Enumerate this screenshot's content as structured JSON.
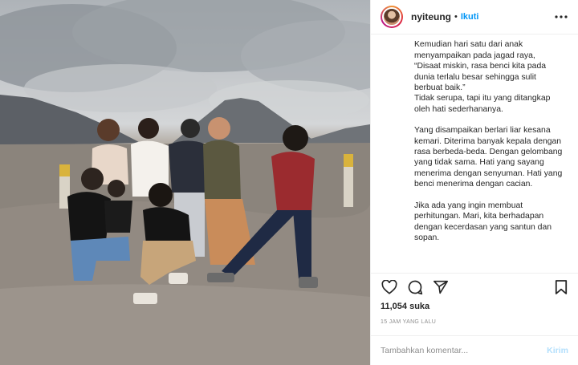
{
  "post": {
    "username": "nyiteung",
    "separator": "•",
    "follow_label": "Ikuti",
    "more_icon": "more-horizontal-icon",
    "caption_paragraphs": [
      "Kemudian hari satu dari anak menyampaikan pada jagad raya,\n“Disaat miskin, rasa benci kita pada dunia terlalu besar sehingga sulit berbuat baik.”\nTidak serupa, tapi itu yang ditangkap oleh hati sederhananya.",
      "Yang disampaikan berlari liar kesana kemari. Diterima banyak kepala dengan rasa berbeda-beda. Dengan gelombang yang tidak sama. Hati yang sayang menerima dengan senyuman. Hati yang benci menerima dengan cacian.",
      "Jika ada yang ingin membuat perhitungan. Mari, kita berhadapan dengan kecerdasan yang santun dan sopan."
    ],
    "likes": "11,054 suka",
    "timestamp": "15 JAM YANG LALU",
    "comment_placeholder": "Tambahkan komentar...",
    "send_label": "Kirim"
  },
  "icons": {
    "like": "heart-icon",
    "comment": "comment-bubble-icon",
    "share": "paper-plane-icon",
    "save": "bookmark-icon"
  },
  "colors": {
    "accent": "#0095f6",
    "send_disabled": "#b2dffc",
    "meta_text": "#8e8e8e",
    "divider": "#efefef"
  }
}
